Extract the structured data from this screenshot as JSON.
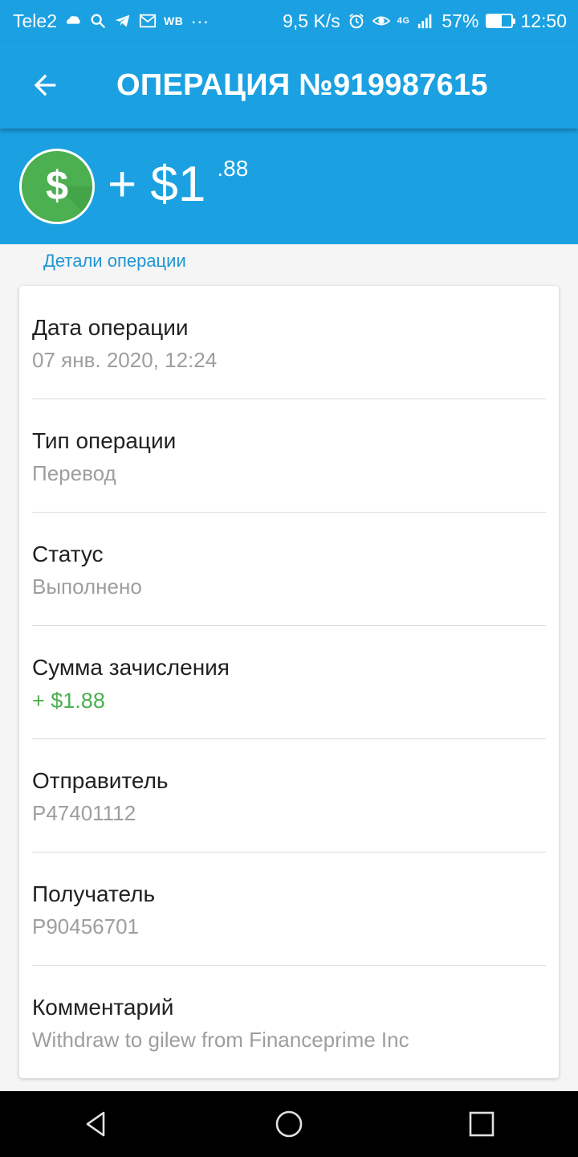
{
  "status_bar": {
    "carrier": "Tele2",
    "small_label": "WB",
    "more": "···",
    "speed": "9,5 K/s",
    "network": "4G",
    "battery": "57%",
    "battery_level": 0.57,
    "time": "12:50"
  },
  "app_bar": {
    "title": "ОПЕРАЦИЯ №919987615",
    "back_icon": "arrow-back-icon"
  },
  "amount": {
    "sign": "+",
    "value": "+ $1",
    "cents": ".88",
    "icon": "dollar-icon",
    "icon_color": "#4caf50"
  },
  "section_label": "Детали операции",
  "details": [
    {
      "label": "Дата операции",
      "value": "07 янв. 2020, 12:24"
    },
    {
      "label": "Тип операции",
      "value": "Перевод"
    },
    {
      "label": "Статус",
      "value": "Выполнено"
    },
    {
      "label": "Сумма зачисления",
      "value": "+ $1.88"
    },
    {
      "label": "Отправитель",
      "value": "P47401112"
    },
    {
      "label": "Получатель",
      "value": "P90456701"
    },
    {
      "label": "Комментарий",
      "value": "Withdraw to gilew from Financeprime Inc"
    }
  ],
  "colors": {
    "primary": "#1ba1e2",
    "accent_green": "#4caf50",
    "link": "#2196d3"
  },
  "nav": {
    "back": "nav-back-icon",
    "home": "nav-home-icon",
    "recents": "nav-recents-icon"
  }
}
